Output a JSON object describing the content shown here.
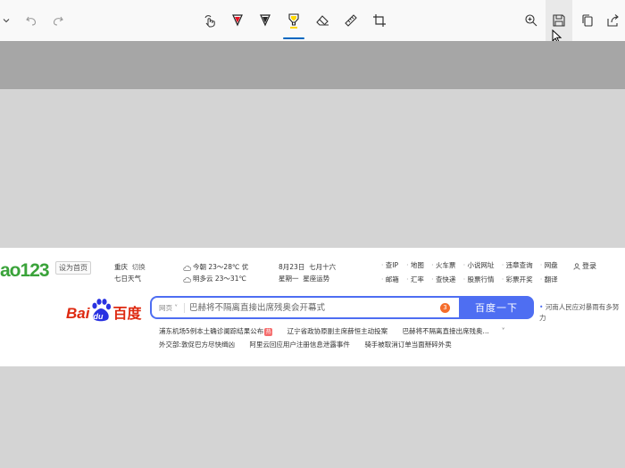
{
  "toolbar": {
    "left": [
      {
        "name": "chevron-down-icon"
      },
      {
        "name": "undo-icon"
      },
      {
        "name": "redo-icon"
      }
    ],
    "center": [
      {
        "name": "touch-writing-icon"
      },
      {
        "name": "ballpoint-pen-icon",
        "color": "#e81123"
      },
      {
        "name": "pencil-icon",
        "color": "#222222"
      },
      {
        "name": "highlighter-icon",
        "color": "#ffd800",
        "active": true
      },
      {
        "name": "eraser-icon"
      },
      {
        "name": "ruler-icon"
      },
      {
        "name": "crop-icon"
      }
    ],
    "right": [
      {
        "name": "zoom-in-icon"
      },
      {
        "name": "save-icon",
        "hovered": true
      },
      {
        "name": "copy-icon"
      },
      {
        "name": "share-icon"
      }
    ]
  },
  "webpage": {
    "logo": {
      "prefix": "ao",
      "suffix": "123"
    },
    "set_home": "设为首页",
    "city": "重庆",
    "switch": "切换",
    "weather_link": "七日天气",
    "today_weather": "今朝 23～28℃ 优",
    "tomorrow_weather": "明多云 23～31℃",
    "date": "8月23日",
    "lunar": "七月十六",
    "weekday": "星期一",
    "fortune": "星座运势",
    "links": [
      "查IP",
      "地图",
      "火车票",
      "小说网址",
      "违章查询",
      "网盘",
      "邮箱",
      "汇率",
      "查快递",
      "股票行情",
      "彩票开奖",
      "翻译"
    ],
    "login": "登录",
    "baidu": {
      "bai": "Bai",
      "du": "du",
      "cn": "百度"
    },
    "search": {
      "scope": "网页",
      "placeholder": "巴赫将不隔离直接出席残奥会开幕式",
      "hot_badge": "3",
      "button": "百度一下"
    },
    "sidenote": "河南人民应对暴雨有多努力",
    "hot_news": [
      [
        "浦东机场5例本土确诊阑踪结果公布",
        "辽宁省政协原副主席薛恒主动投案",
        "巴赫将不隔离直接出席残奥..."
      ],
      [
        "外交部:敦促巴方尽快缉凶",
        "阿里云回应用户注册信息泄露事件",
        "骑手被取消订单当面掰碎外卖"
      ]
    ],
    "hot_tag": "热"
  }
}
